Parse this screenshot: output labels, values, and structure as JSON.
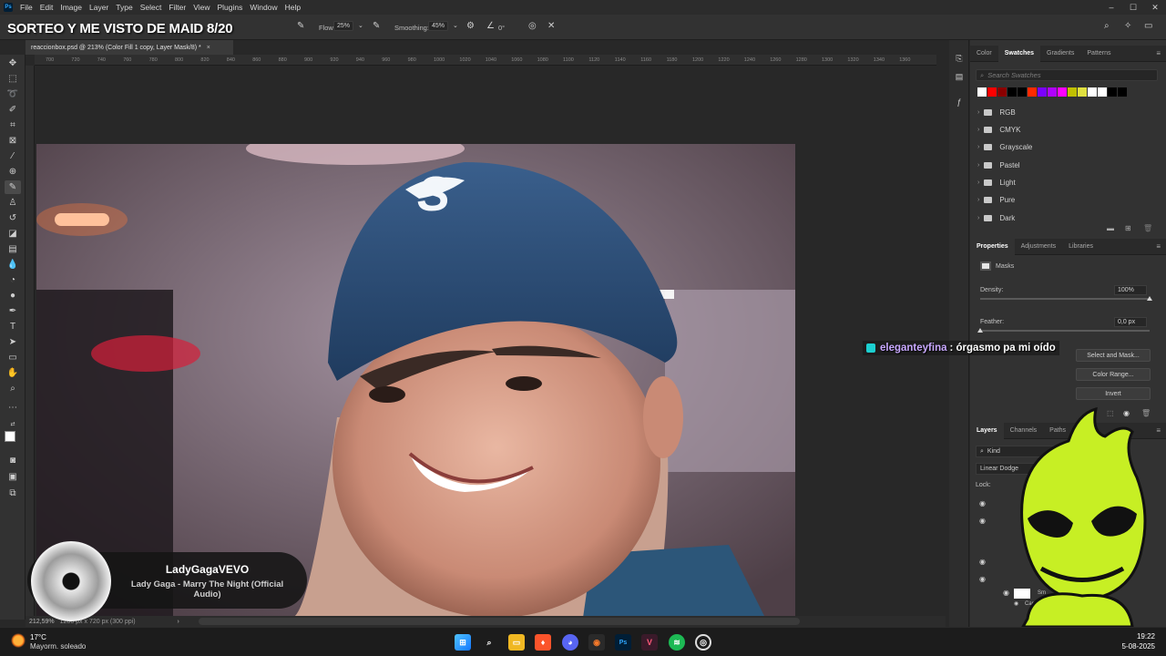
{
  "app": {
    "icon_label": "Ps",
    "overlay_title": "SORTEO Y ME VISTO DE MAID 8/20"
  },
  "menu": [
    "File",
    "Edit",
    "Image",
    "Layer",
    "Type",
    "Select",
    "Filter",
    "View",
    "Plugins",
    "Window",
    "Help"
  ],
  "window_controls": {
    "minimize": "–",
    "maximize": "☐",
    "close": "✕"
  },
  "options": {
    "flow_label": "Flow:",
    "flow_value": "25%",
    "smoothing_label": "Smoothing:",
    "smoothing_value": "45%",
    "angle_value": "0°"
  },
  "document": {
    "tab_title": "reaccionbox.psd @ 213% (Color Fill 1 copy, Layer Mask/8) *",
    "close": "×",
    "status_zoom": "212,59%",
    "status_info": "1280 px x 720 px (300 ppi)",
    "status_arrow": "›"
  },
  "ruler_ticks": [
    "700",
    "720",
    "740",
    "760",
    "780",
    "800",
    "820",
    "840",
    "860",
    "880",
    "900",
    "920",
    "940",
    "960",
    "980",
    "1000",
    "1020",
    "1040",
    "1060",
    "1080",
    "1100",
    "1120",
    "1140",
    "1160",
    "1180",
    "1200",
    "1220",
    "1240",
    "1260",
    "1280",
    "1300",
    "1320",
    "1340",
    "1360"
  ],
  "swatches": {
    "tabs": [
      "Color",
      "Swatches",
      "Gradients",
      "Patterns"
    ],
    "selected_tab": "Swatches",
    "search_placeholder": "Search Swatches",
    "colors": [
      "#ffffff",
      "#ff0000",
      "#8b0000",
      "#000000",
      "#000000",
      "#ff2a00",
      "#7a00ff",
      "#b000ff",
      "#ff00ff",
      "#c0c000",
      "#e0e040",
      "#ffffff",
      "#ffffff",
      "#000000",
      "#000000"
    ],
    "folders": [
      "RGB",
      "CMYK",
      "Grayscale",
      "Pastel",
      "Light",
      "Pure",
      "Dark"
    ]
  },
  "properties": {
    "tabs": [
      "Properties",
      "Adjustments",
      "Libraries"
    ],
    "selected_tab": "Properties",
    "section": "Masks",
    "density_label": "Density:",
    "density_value": "100%",
    "density_level": 100,
    "feather_label": "Feather:",
    "feather_value": "0,0 px",
    "feather_level": 0,
    "select_and_mask": "Select and Mask...",
    "color_range": "Color Range...",
    "invert": "Invert"
  },
  "layers": {
    "tabs": [
      "Layers",
      "Channels",
      "Paths"
    ],
    "selected_tab": "Layers",
    "filter_label": "Kind",
    "blend_mode": "Linear Dodge",
    "lock_label": "Lock:",
    "layer_names": [
      "Sm",
      "Camera Raw Filt"
    ]
  },
  "chat": {
    "user": "eleganteyfina",
    "message": ": órgasmo pa mi oído"
  },
  "music": {
    "artist": "LadyGagaVEVO",
    "track": "Lady Gaga - Marry The Night (Official Audio)"
  },
  "taskbar": {
    "temperature": "17°C",
    "weather": "Mayorm. soleado",
    "time": "19:22",
    "date": "5-08-2025"
  }
}
